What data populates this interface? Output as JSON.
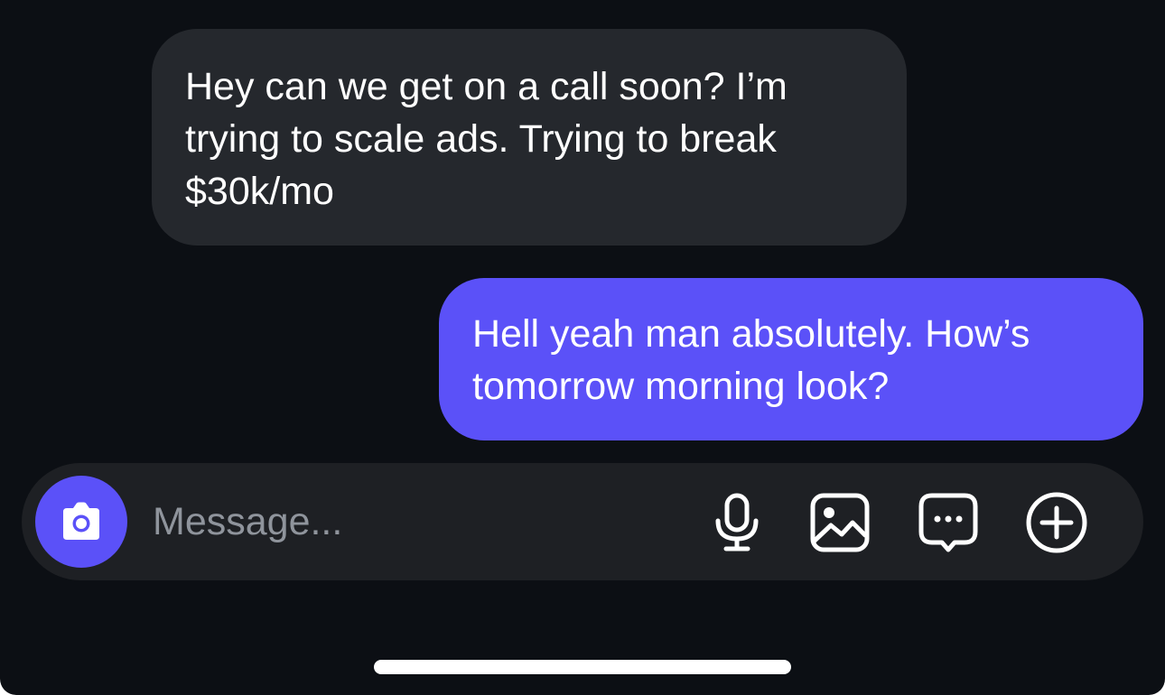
{
  "conversation": {
    "messages": [
      {
        "direction": "received",
        "text": "Hey can we get on a call soon? I’m\ntrying to scale ads. Trying to break\n$30k/mo"
      },
      {
        "direction": "sent",
        "text": "Hell yeah man absolutely. How’s\ntomorrow morning look?"
      }
    ]
  },
  "composer": {
    "placeholder": "Message...",
    "value": "",
    "icons": [
      "camera-icon",
      "microphone-icon",
      "image-icon",
      "sticker-chat-icon",
      "plus-circle-icon"
    ]
  },
  "colors": {
    "background": "#0c0f14",
    "received_bubble": "#25282d",
    "sent_bubble": "#5b51f8",
    "composer": "#1e2024",
    "accent": "#5b51f8",
    "placeholder": "#8f949c"
  }
}
